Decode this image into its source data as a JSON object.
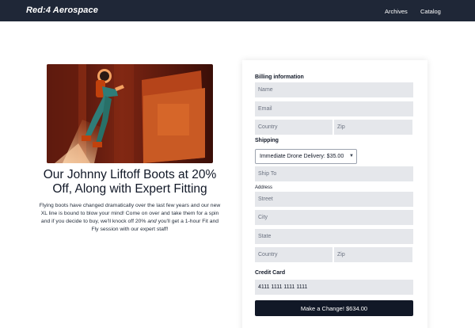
{
  "header": {
    "brand": "Red:4 Aerospace",
    "nav": {
      "archives": "Archives",
      "catalog": "Catalog"
    }
  },
  "hero": {
    "title": "Our Johnny Liftoff Boots at 20% Off, Along with Expert Fitting",
    "body_parts": [
      "Flying boots have changed dramatically over the last few years and our new XL line is bound to blow your mind! Come on over and take them for a spin and if you decide to buy, we'll knock off 20% ",
      "and",
      " you'll get a 1-hour Fit and Fly session with our expert staff!"
    ]
  },
  "form": {
    "billing_label": "Billing information",
    "name_placeholder": "Name",
    "email_placeholder": "Email",
    "country_placeholder": "Country",
    "zip_placeholder": "Zip",
    "shipping_label": "Shipping",
    "shipping_option": "Immediate Drone Delivery: $35.00",
    "ship_to_placeholder": "Ship To",
    "address_label": "Address",
    "street_placeholder": "Street",
    "city_placeholder": "City",
    "state_placeholder": "State",
    "country2_placeholder": "Country",
    "zip2_placeholder": "Zip",
    "credit_card_label": "Credit Card",
    "card_number": "4111 1111 1111 1111",
    "submit_label": "Make a Change! $634.00"
  },
  "colors": {
    "header_bg": "#1f2737",
    "field_bg": "#e5e7eb",
    "button_bg": "#111827",
    "hero_orange": "#c2410c"
  },
  "icons": [
    "chevron-down-icon"
  ]
}
